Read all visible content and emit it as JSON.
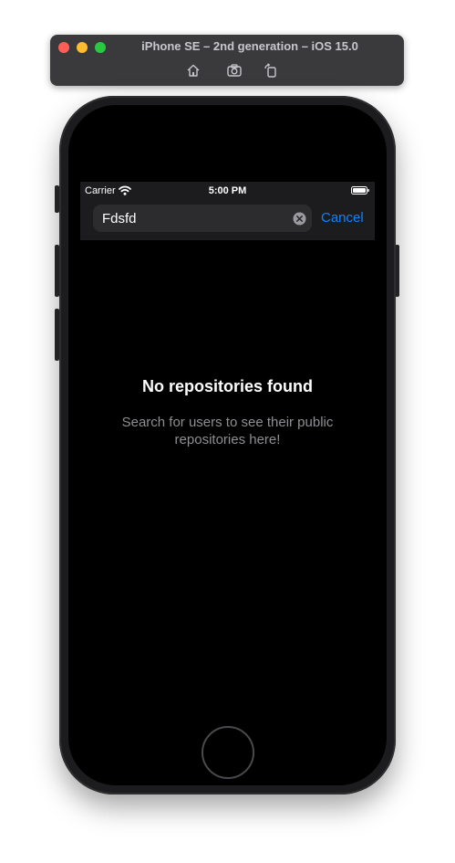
{
  "simulator": {
    "title": "iPhone SE – 2nd generation – iOS 15.0",
    "toolbar": [
      "home-icon",
      "screenshot-icon",
      "rotate-icon"
    ]
  },
  "status_bar": {
    "carrier": "Carrier",
    "time": "5:00 PM"
  },
  "search": {
    "value": "Fdsfd",
    "cancel_label": "Cancel"
  },
  "empty_state": {
    "title": "No repositories found",
    "message": "Search for users to see their public repositories here!"
  },
  "colors": {
    "accent": "#0a84ff",
    "background": "#000000",
    "bar": "#1c1c1e",
    "secondary_text": "#8e8e93"
  }
}
